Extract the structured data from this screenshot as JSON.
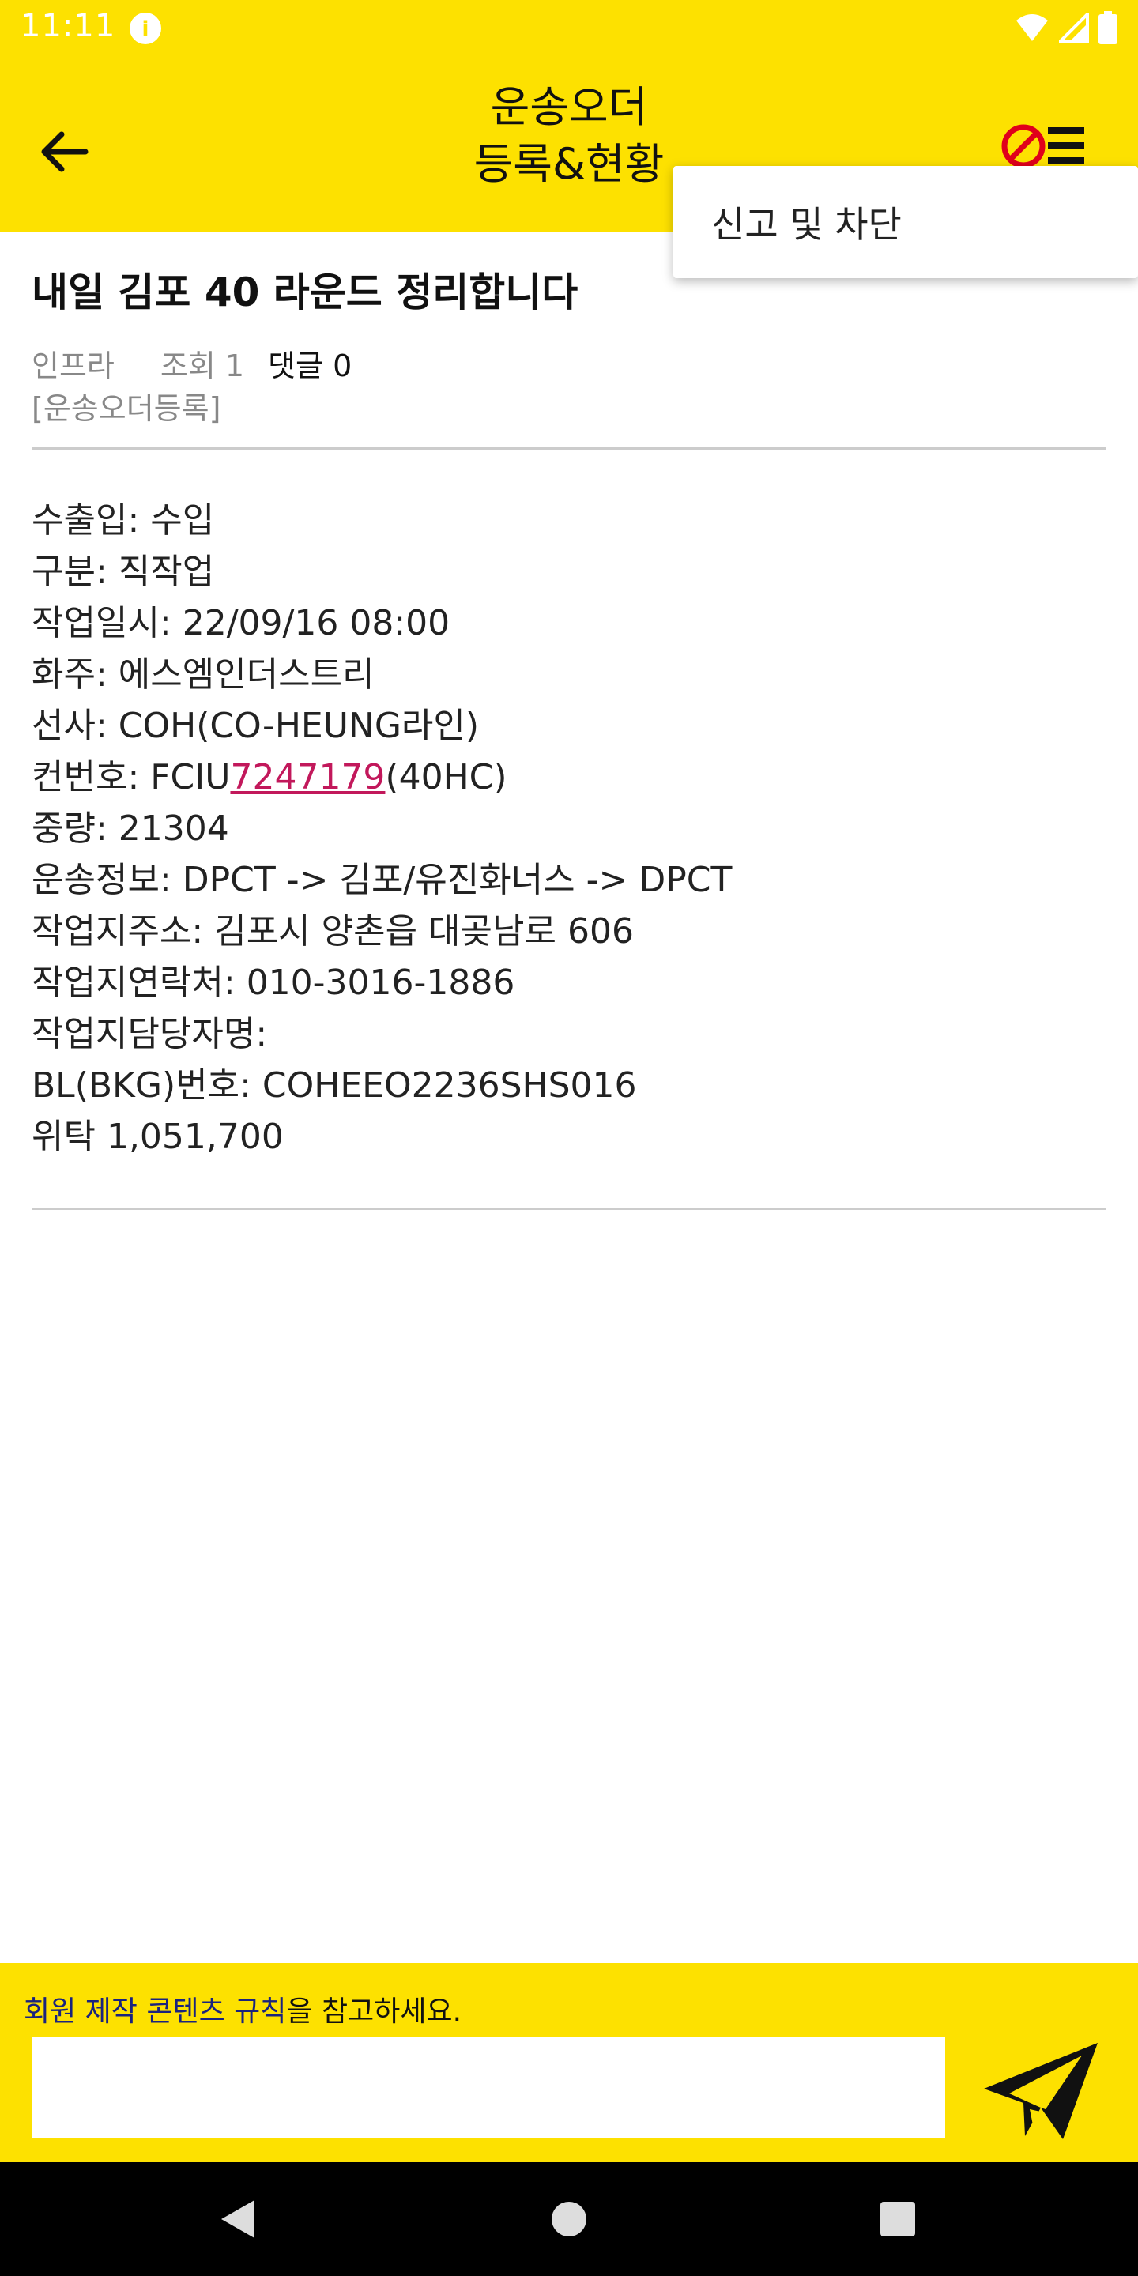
{
  "status_bar": {
    "time": "11:11",
    "icons": [
      "app-notification-icon",
      "wifi-icon",
      "signal-icon",
      "battery-icon"
    ]
  },
  "header": {
    "title_line1": "운송오더",
    "title_line2": "등록&현황",
    "back_icon": "arrow-left-icon",
    "menu_icons": [
      "block-icon",
      "menu-icon"
    ],
    "background": "#FDE100"
  },
  "popup_menu": {
    "items": [
      "신고 및 차단"
    ]
  },
  "post": {
    "title": "내일 김포 40 라운드 정리합니다",
    "author": "인프라",
    "views": "조회 1",
    "comments": "댓글 0",
    "category": "[운송오더등록]",
    "lines": [
      "수출입: 수입",
      "구분: 직작업",
      "작업일시: 22/09/16 08:00",
      "화주: 에스엠인더스트리",
      "선사: COH(CO-HEUNG라인)",
      "",
      "중량: 21304",
      "운송정보: DPCT -> 김포/유진화너스 -> DPCT",
      "작업지주소: 김포시 양촌읍 대곶남로 606",
      "작업지연락처: 010-3016-1886",
      "작업지담당자명:",
      "BL(BKG)번호: COHEEO2236SHS016",
      "위탁 1,051,700"
    ],
    "container": {
      "prefix": "컨번호: FCIU",
      "number": "7247179",
      "suffix": "(40HC)"
    },
    "link_color": "#C2185B"
  },
  "footer": {
    "rule_link": "회원 제작 콘텐츠 규칙",
    "rule_suffix": "을 참고하세요.",
    "comment_placeholder": "",
    "send_icon": "send-icon"
  },
  "nav_bar": {
    "icons": [
      "nav-back-icon",
      "nav-home-icon",
      "nav-recents-icon"
    ]
  }
}
